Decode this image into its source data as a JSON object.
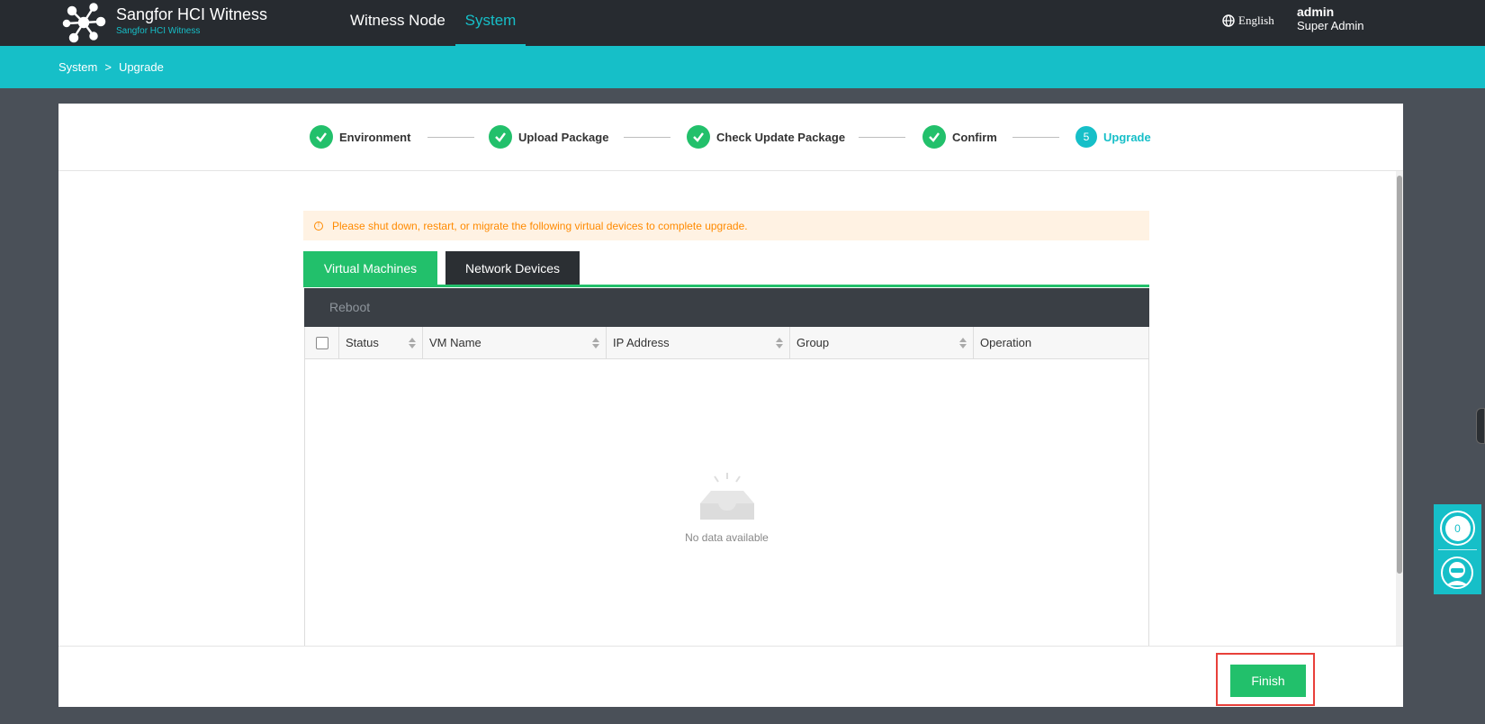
{
  "header": {
    "brand_title": "Sangfor HCI Witness",
    "brand_subtitle": "Sangfor HCI Witness",
    "nav": [
      {
        "label": "Witness Node",
        "active": false
      },
      {
        "label": "System",
        "active": true
      }
    ],
    "language": "English",
    "user": {
      "name": "admin",
      "role": "Super Admin"
    }
  },
  "breadcrumb": {
    "items": [
      "System",
      "Upgrade"
    ],
    "separator": ">"
  },
  "steps": [
    {
      "label": "Environment",
      "state": "done"
    },
    {
      "label": "Upload Package",
      "state": "done"
    },
    {
      "label": "Check Update Package",
      "state": "done"
    },
    {
      "label": "Confirm",
      "state": "done"
    },
    {
      "label": "Upgrade",
      "state": "active",
      "number": "5"
    }
  ],
  "warning": {
    "icon": "info-icon",
    "text": "Please shut down, restart, or migrate the following virtual devices to complete upgrade."
  },
  "tabs": [
    {
      "label": "Virtual Machines",
      "active": true
    },
    {
      "label": "Network Devices",
      "active": false
    }
  ],
  "toolbar": {
    "reboot_label": "Reboot"
  },
  "table": {
    "columns": [
      "Status",
      "VM Name",
      "IP Address",
      "Group",
      "Operation"
    ],
    "rows": [],
    "empty_text": "No data available"
  },
  "footer": {
    "finish_label": "Finish"
  },
  "widget": {
    "count": "0"
  },
  "colors": {
    "accent": "#16bfc8",
    "success": "#22c06b",
    "header_bg": "#272b30",
    "warning": "#ff8a00",
    "highlight": "#e8403a"
  }
}
